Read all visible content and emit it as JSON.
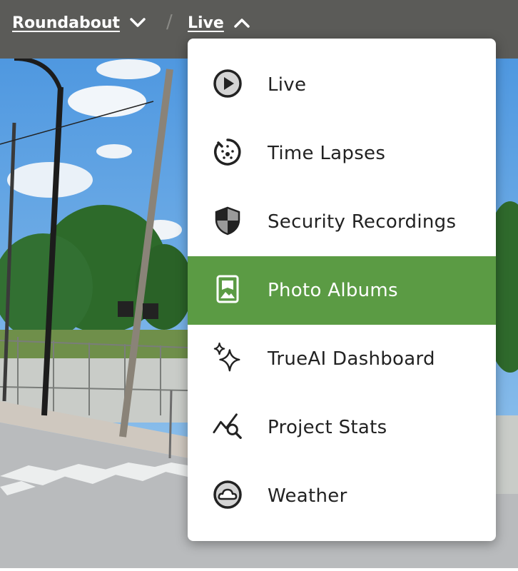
{
  "breadcrumb": {
    "project": "Roundabout",
    "separator": "/",
    "current": "Live"
  },
  "menu": {
    "items": [
      {
        "label": "Live",
        "icon": "play-circle-icon"
      },
      {
        "label": "Time Lapses",
        "icon": "timelapse-icon"
      },
      {
        "label": "Security Recordings",
        "icon": "shield-icon"
      },
      {
        "label": "Photo Albums",
        "icon": "photo-album-icon",
        "active": true
      },
      {
        "label": "TrueAI Dashboard",
        "icon": "sparkles-icon"
      },
      {
        "label": "Project Stats",
        "icon": "chart-search-icon"
      },
      {
        "label": "Weather",
        "icon": "cloud-icon"
      }
    ]
  },
  "colors": {
    "topbar": "#5b5b58",
    "active_item": "#5b9b44",
    "text": "#222222",
    "sky": "#5ea6e8"
  }
}
